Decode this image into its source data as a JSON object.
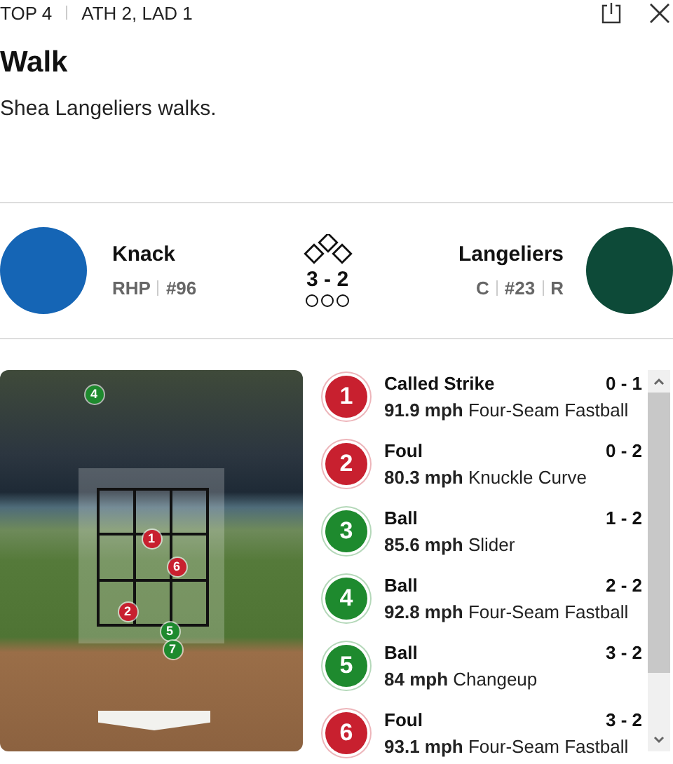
{
  "header": {
    "inning": "TOP 4",
    "score": "ATH 2, LAD 1"
  },
  "title": "Walk",
  "description": "Shea Langeliers walks.",
  "pitcher": {
    "name": "Knack",
    "details": [
      "RHP",
      "#96"
    ]
  },
  "batter": {
    "name": "Langeliers",
    "details": [
      "C",
      "#23",
      "R"
    ]
  },
  "bases": [
    {
      "occupied": false
    },
    {
      "occupied": false
    },
    {
      "occupied": false
    }
  ],
  "count": "3 - 2",
  "outs": [
    {
      "filled": false
    },
    {
      "filled": false
    },
    {
      "filled": false
    }
  ],
  "zone_markers": [
    {
      "label": "4",
      "color": "#1e8a2e"
    },
    {
      "label": "1",
      "color": "#c8202f"
    },
    {
      "label": "6",
      "color": "#c8202f"
    },
    {
      "label": "2",
      "color": "#c8202f"
    },
    {
      "label": "5",
      "color": "#1e8a2e"
    },
    {
      "label": "7",
      "color": "#1e8a2e"
    }
  ],
  "pitches": [
    {
      "number": "1",
      "color": "#c8202f",
      "result": "Called Strike",
      "count": "0 - 1",
      "speed": "91.9 mph",
      "type": "Four-Seam Fastball"
    },
    {
      "number": "2",
      "color": "#c8202f",
      "result": "Foul",
      "count": "0 - 2",
      "speed": "80.3 mph",
      "type": "Knuckle Curve"
    },
    {
      "number": "3",
      "color": "#1e8a2e",
      "result": "Ball",
      "count": "1 - 2",
      "speed": "85.6 mph",
      "type": "Slider"
    },
    {
      "number": "4",
      "color": "#1e8a2e",
      "result": "Ball",
      "count": "2 - 2",
      "speed": "92.8 mph",
      "type": "Four-Seam Fastball"
    },
    {
      "number": "5",
      "color": "#1e8a2e",
      "result": "Ball",
      "count": "3 - 2",
      "speed": "84 mph",
      "type": "Changeup"
    },
    {
      "number": "6",
      "color": "#c8202f",
      "result": "Foul",
      "count": "3 - 2",
      "speed": "93.1 mph",
      "type": "Four-Seam Fastball"
    }
  ]
}
